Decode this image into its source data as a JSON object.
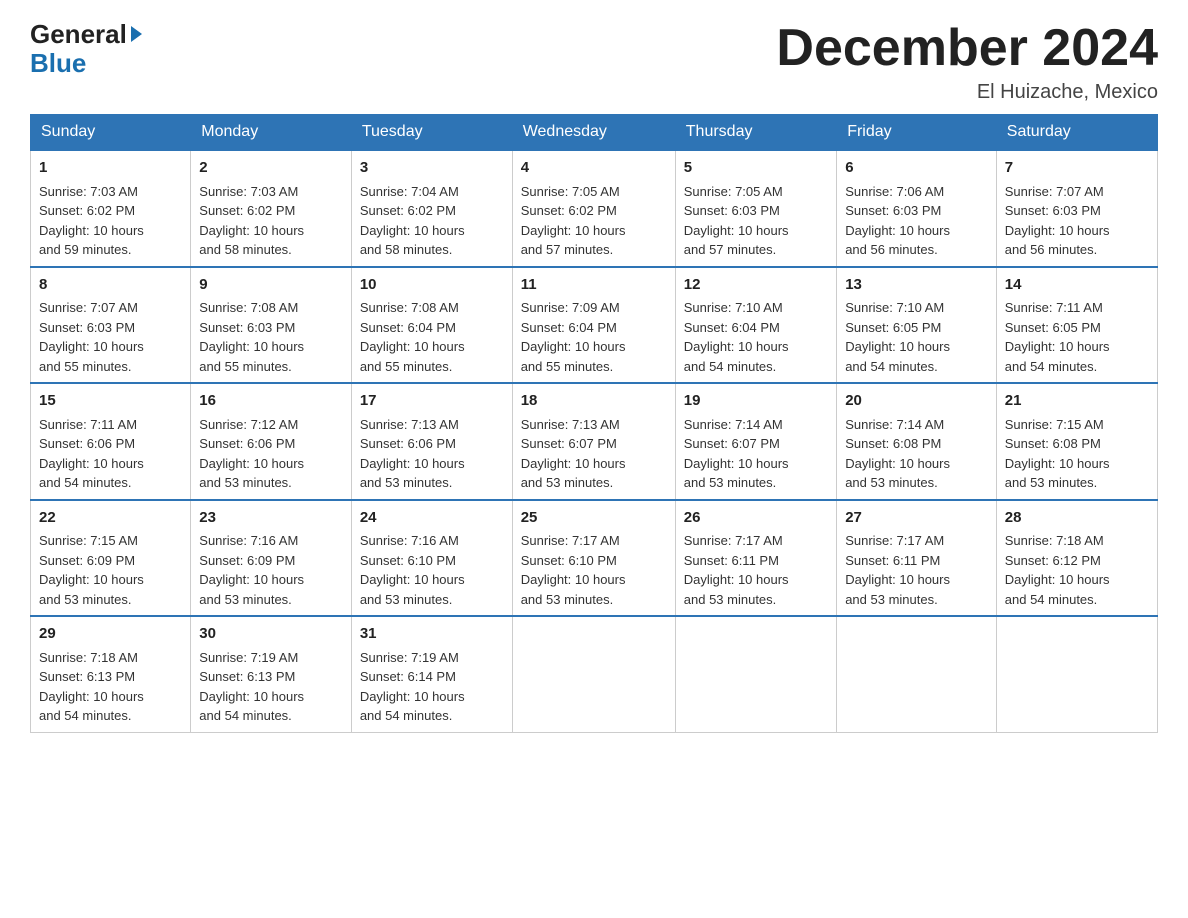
{
  "header": {
    "logo_general": "General",
    "logo_blue": "Blue",
    "title": "December 2024",
    "location": "El Huizache, Mexico"
  },
  "days_of_week": [
    "Sunday",
    "Monday",
    "Tuesday",
    "Wednesday",
    "Thursday",
    "Friday",
    "Saturday"
  ],
  "weeks": [
    [
      {
        "day": "1",
        "info": "Sunrise: 7:03 AM\nSunset: 6:02 PM\nDaylight: 10 hours\nand 59 minutes."
      },
      {
        "day": "2",
        "info": "Sunrise: 7:03 AM\nSunset: 6:02 PM\nDaylight: 10 hours\nand 58 minutes."
      },
      {
        "day": "3",
        "info": "Sunrise: 7:04 AM\nSunset: 6:02 PM\nDaylight: 10 hours\nand 58 minutes."
      },
      {
        "day": "4",
        "info": "Sunrise: 7:05 AM\nSunset: 6:02 PM\nDaylight: 10 hours\nand 57 minutes."
      },
      {
        "day": "5",
        "info": "Sunrise: 7:05 AM\nSunset: 6:03 PM\nDaylight: 10 hours\nand 57 minutes."
      },
      {
        "day": "6",
        "info": "Sunrise: 7:06 AM\nSunset: 6:03 PM\nDaylight: 10 hours\nand 56 minutes."
      },
      {
        "day": "7",
        "info": "Sunrise: 7:07 AM\nSunset: 6:03 PM\nDaylight: 10 hours\nand 56 minutes."
      }
    ],
    [
      {
        "day": "8",
        "info": "Sunrise: 7:07 AM\nSunset: 6:03 PM\nDaylight: 10 hours\nand 55 minutes."
      },
      {
        "day": "9",
        "info": "Sunrise: 7:08 AM\nSunset: 6:03 PM\nDaylight: 10 hours\nand 55 minutes."
      },
      {
        "day": "10",
        "info": "Sunrise: 7:08 AM\nSunset: 6:04 PM\nDaylight: 10 hours\nand 55 minutes."
      },
      {
        "day": "11",
        "info": "Sunrise: 7:09 AM\nSunset: 6:04 PM\nDaylight: 10 hours\nand 55 minutes."
      },
      {
        "day": "12",
        "info": "Sunrise: 7:10 AM\nSunset: 6:04 PM\nDaylight: 10 hours\nand 54 minutes."
      },
      {
        "day": "13",
        "info": "Sunrise: 7:10 AM\nSunset: 6:05 PM\nDaylight: 10 hours\nand 54 minutes."
      },
      {
        "day": "14",
        "info": "Sunrise: 7:11 AM\nSunset: 6:05 PM\nDaylight: 10 hours\nand 54 minutes."
      }
    ],
    [
      {
        "day": "15",
        "info": "Sunrise: 7:11 AM\nSunset: 6:06 PM\nDaylight: 10 hours\nand 54 minutes."
      },
      {
        "day": "16",
        "info": "Sunrise: 7:12 AM\nSunset: 6:06 PM\nDaylight: 10 hours\nand 53 minutes."
      },
      {
        "day": "17",
        "info": "Sunrise: 7:13 AM\nSunset: 6:06 PM\nDaylight: 10 hours\nand 53 minutes."
      },
      {
        "day": "18",
        "info": "Sunrise: 7:13 AM\nSunset: 6:07 PM\nDaylight: 10 hours\nand 53 minutes."
      },
      {
        "day": "19",
        "info": "Sunrise: 7:14 AM\nSunset: 6:07 PM\nDaylight: 10 hours\nand 53 minutes."
      },
      {
        "day": "20",
        "info": "Sunrise: 7:14 AM\nSunset: 6:08 PM\nDaylight: 10 hours\nand 53 minutes."
      },
      {
        "day": "21",
        "info": "Sunrise: 7:15 AM\nSunset: 6:08 PM\nDaylight: 10 hours\nand 53 minutes."
      }
    ],
    [
      {
        "day": "22",
        "info": "Sunrise: 7:15 AM\nSunset: 6:09 PM\nDaylight: 10 hours\nand 53 minutes."
      },
      {
        "day": "23",
        "info": "Sunrise: 7:16 AM\nSunset: 6:09 PM\nDaylight: 10 hours\nand 53 minutes."
      },
      {
        "day": "24",
        "info": "Sunrise: 7:16 AM\nSunset: 6:10 PM\nDaylight: 10 hours\nand 53 minutes."
      },
      {
        "day": "25",
        "info": "Sunrise: 7:17 AM\nSunset: 6:10 PM\nDaylight: 10 hours\nand 53 minutes."
      },
      {
        "day": "26",
        "info": "Sunrise: 7:17 AM\nSunset: 6:11 PM\nDaylight: 10 hours\nand 53 minutes."
      },
      {
        "day": "27",
        "info": "Sunrise: 7:17 AM\nSunset: 6:11 PM\nDaylight: 10 hours\nand 53 minutes."
      },
      {
        "day": "28",
        "info": "Sunrise: 7:18 AM\nSunset: 6:12 PM\nDaylight: 10 hours\nand 54 minutes."
      }
    ],
    [
      {
        "day": "29",
        "info": "Sunrise: 7:18 AM\nSunset: 6:13 PM\nDaylight: 10 hours\nand 54 minutes."
      },
      {
        "day": "30",
        "info": "Sunrise: 7:19 AM\nSunset: 6:13 PM\nDaylight: 10 hours\nand 54 minutes."
      },
      {
        "day": "31",
        "info": "Sunrise: 7:19 AM\nSunset: 6:14 PM\nDaylight: 10 hours\nand 54 minutes."
      },
      null,
      null,
      null,
      null
    ]
  ]
}
